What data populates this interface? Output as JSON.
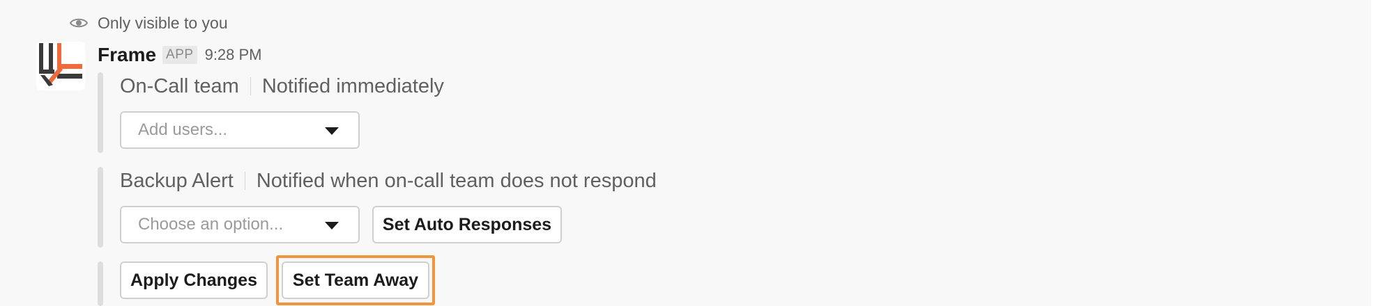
{
  "ephemeral_notice": {
    "icon": "eye-icon",
    "text": "Only visible to you"
  },
  "message": {
    "app_name": "Frame",
    "app_badge": "APP",
    "timestamp": "9:28 PM",
    "avatar": {
      "icon": "frame-logo-icon",
      "colors": [
        "#3a3a3a",
        "#f06a3c"
      ]
    }
  },
  "sections": [
    {
      "title": "On-Call team",
      "description": "Notified immediately",
      "select": {
        "placeholder": "Add users..."
      }
    },
    {
      "title": "Backup Alert",
      "description": "Notified when on-call team does not respond",
      "select": {
        "placeholder": "Choose an option..."
      },
      "button": "Set Auto Responses"
    }
  ],
  "actions": {
    "apply": "Apply Changes",
    "away": "Set Team Away"
  },
  "colors": {
    "highlight": "#f0953e",
    "accent_orange": "#f06a3c",
    "dark_gray": "#3a3a3a"
  }
}
